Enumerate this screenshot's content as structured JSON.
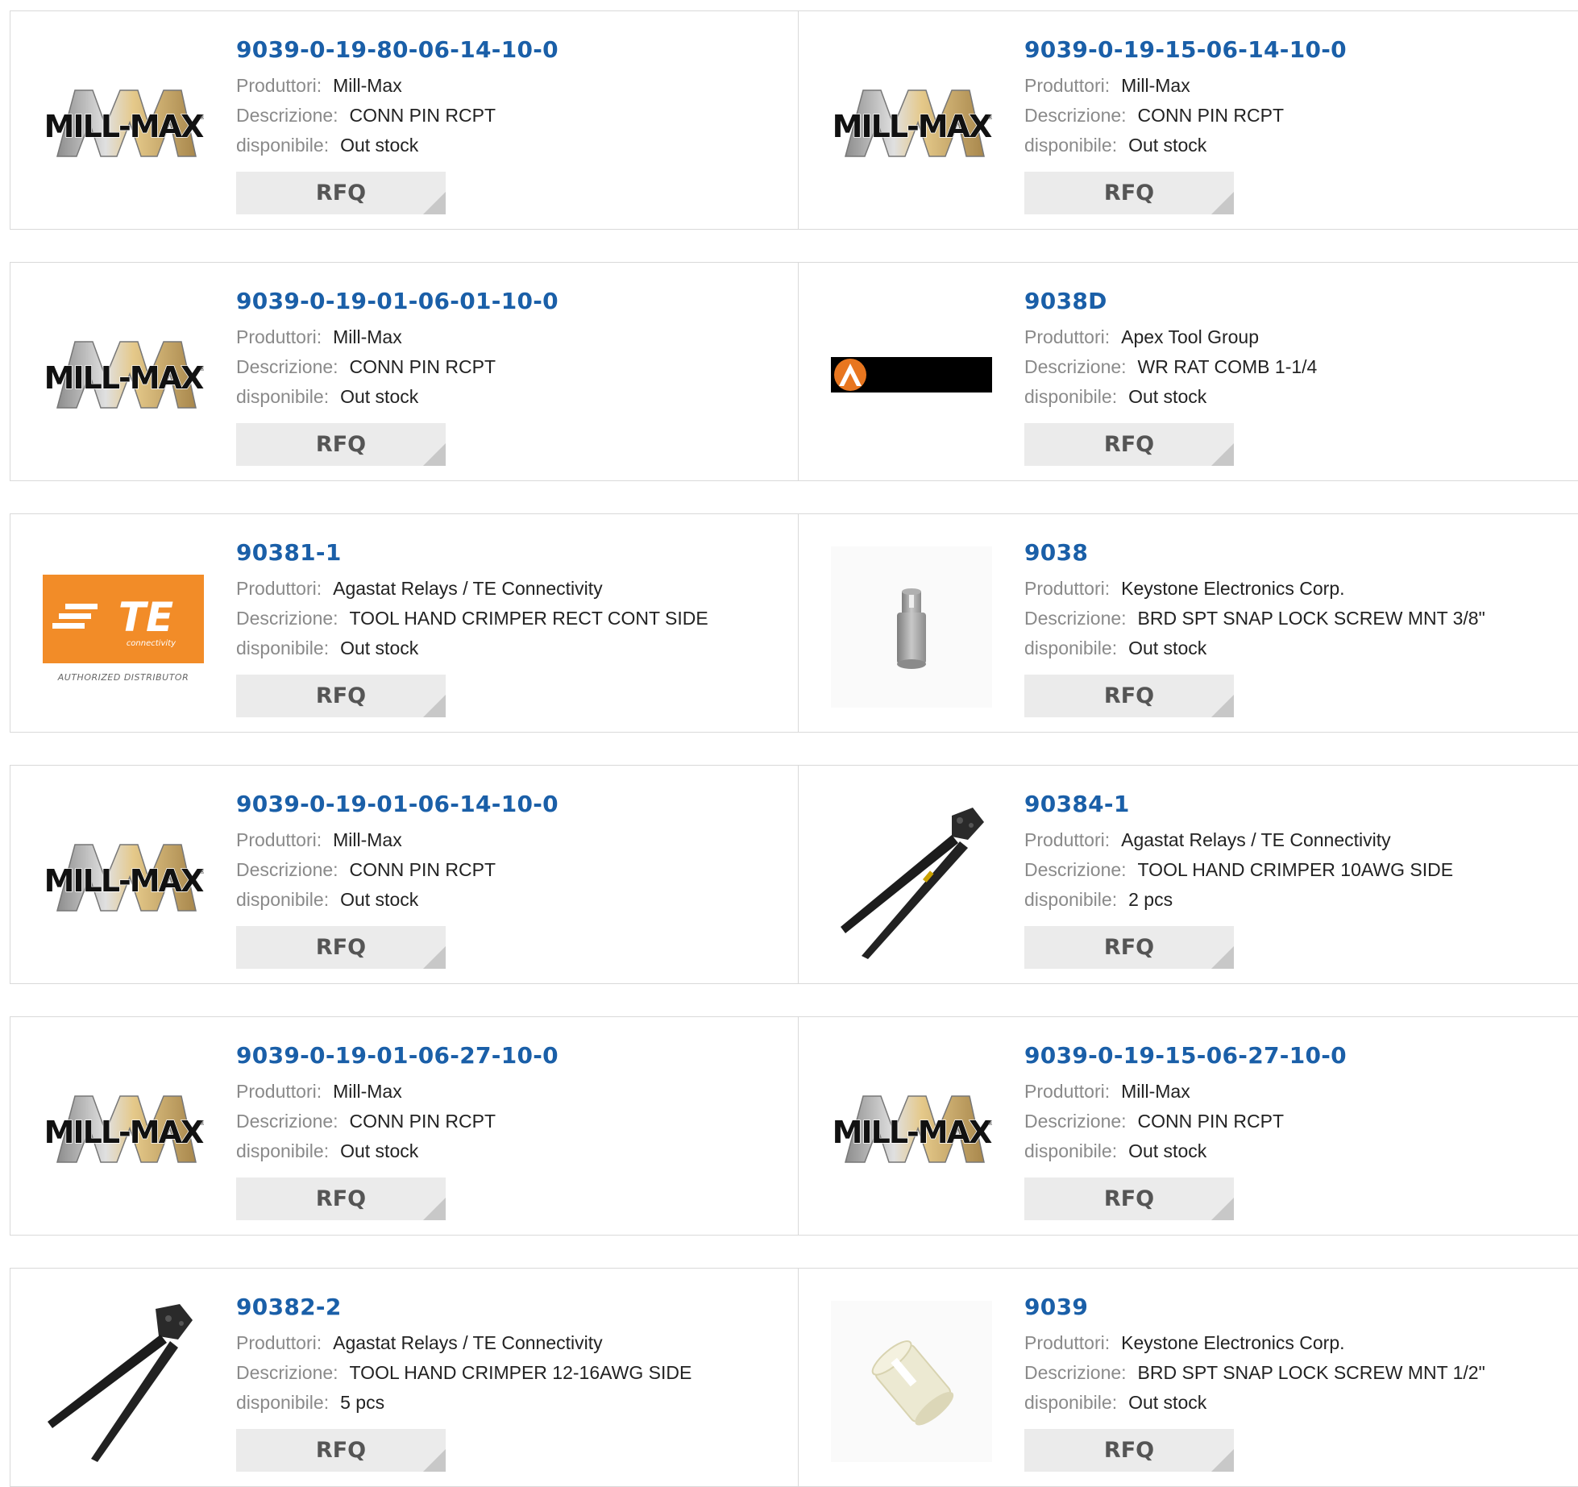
{
  "labels": {
    "manufacturer": "Produttori:",
    "description": "Descrizione:",
    "availability": "disponibile:",
    "rfq": "RFQ"
  },
  "products": [
    {
      "part": "9039-0-19-80-06-14-10-0",
      "manufacturer": "Mill-Max",
      "description": "CONN PIN RCPT",
      "availability": "Out stock",
      "image": "mill-max-logo"
    },
    {
      "part": "9039-0-19-15-06-14-10-0",
      "manufacturer": "Mill-Max",
      "description": "CONN PIN RCPT",
      "availability": "Out stock",
      "image": "mill-max-logo"
    },
    {
      "part": "9039-0-19-01-06-01-10-0",
      "manufacturer": "Mill-Max",
      "description": "CONN PIN RCPT",
      "availability": "Out stock",
      "image": "mill-max-logo"
    },
    {
      "part": "9038D",
      "manufacturer": "Apex Tool Group",
      "description": "WR RAT COMB 1-1/4",
      "availability": "Out stock",
      "image": "apex-logo"
    },
    {
      "part": "90381-1",
      "manufacturer": "Agastat Relays / TE Connectivity",
      "description": "TOOL HAND CRIMPER RECT CONT SIDE",
      "availability": "Out stock",
      "image": "te-logo"
    },
    {
      "part": "9038",
      "manufacturer": "Keystone Electronics Corp.",
      "description": "BRD SPT SNAP LOCK SCREW MNT 3/8\"",
      "availability": "Out stock",
      "image": "board-support-grey"
    },
    {
      "part": "9039-0-19-01-06-14-10-0",
      "manufacturer": "Mill-Max",
      "description": "CONN PIN RCPT",
      "availability": "Out stock",
      "image": "mill-max-logo"
    },
    {
      "part": "90384-1",
      "manufacturer": "Agastat Relays / TE Connectivity",
      "description": "TOOL HAND CRIMPER 10AWG SIDE",
      "availability": "2 pcs",
      "image": "crimper-tool"
    },
    {
      "part": "9039-0-19-01-06-27-10-0",
      "manufacturer": "Mill-Max",
      "description": "CONN PIN RCPT",
      "availability": "Out stock",
      "image": "mill-max-logo"
    },
    {
      "part": "9039-0-19-15-06-27-10-0",
      "manufacturer": "Mill-Max",
      "description": "CONN PIN RCPT",
      "availability": "Out stock",
      "image": "mill-max-logo"
    },
    {
      "part": "90382-2",
      "manufacturer": "Agastat Relays / TE Connectivity",
      "description": "TOOL HAND CRIMPER 12-16AWG SIDE",
      "availability": "5 pcs",
      "image": "crimper-tool"
    },
    {
      "part": "9039",
      "manufacturer": "Keystone Electronics Corp.",
      "description": "BRD SPT SNAP LOCK SCREW MNT 1/2\"",
      "availability": "Out stock",
      "image": "board-support-white"
    }
  ],
  "logo_text": {
    "millmax": "MILL-MAX",
    "te": "TE",
    "te_sub": "connectivity",
    "te_authorized": "AUTHORIZED DISTRIBUTOR"
  },
  "colors": {
    "link": "#1a5fa8",
    "te_orange": "#f28c28"
  }
}
